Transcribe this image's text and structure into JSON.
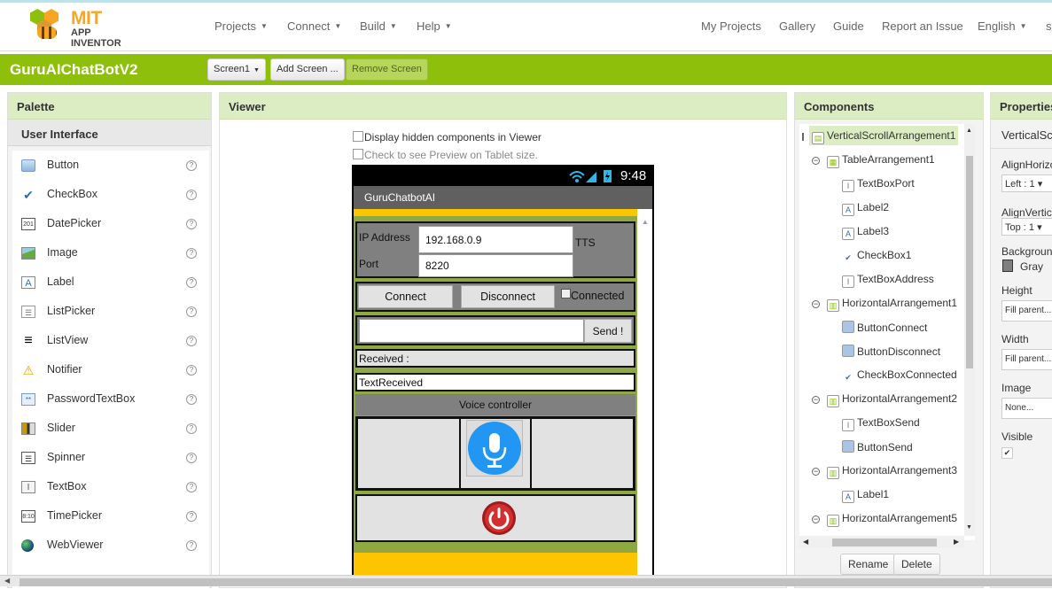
{
  "header": {
    "logo_mit": "MIT",
    "logo_ai": "APP INVENTOR",
    "menus": [
      "Projects",
      "Connect",
      "Build",
      "Help"
    ],
    "links": [
      "My Projects",
      "Gallery",
      "Guide",
      "Report an Issue"
    ],
    "language": "English",
    "cut_link": "s"
  },
  "projectbar": {
    "project_name": "GuruAIChatBotV2",
    "screen_select": "Screen1",
    "add_screen": "Add Screen ...",
    "remove_screen": "Remove Screen"
  },
  "palette": {
    "title": "Palette",
    "section": "User Interface",
    "help_glyph": "?",
    "items": [
      {
        "label": "Button",
        "icon": "button-icon"
      },
      {
        "label": "CheckBox",
        "icon": "checkbox-icon"
      },
      {
        "label": "DatePicker",
        "icon": "datepicker-icon"
      },
      {
        "label": "Image",
        "icon": "image-icon"
      },
      {
        "label": "Label",
        "icon": "label-icon"
      },
      {
        "label": "ListPicker",
        "icon": "listpicker-icon"
      },
      {
        "label": "ListView",
        "icon": "listview-icon"
      },
      {
        "label": "Notifier",
        "icon": "notifier-icon"
      },
      {
        "label": "PasswordTextBox",
        "icon": "password-icon"
      },
      {
        "label": "Slider",
        "icon": "slider-icon"
      },
      {
        "label": "Spinner",
        "icon": "spinner-icon"
      },
      {
        "label": "TextBox",
        "icon": "textbox-icon"
      },
      {
        "label": "TimePicker",
        "icon": "timepicker-icon"
      },
      {
        "label": "WebViewer",
        "icon": "webviewer-icon"
      }
    ]
  },
  "viewer": {
    "title": "Viewer",
    "display_hidden": "Display hidden components in Viewer",
    "tablet_preview": "Check to see Preview on Tablet size.",
    "phone": {
      "time": "9:48",
      "app_title": "GuruChatbotAI",
      "ip_label": "IP Address",
      "ip_value": "192.168.0.9",
      "tts_label": "TTS",
      "port_label": "Port",
      "port_value": "8220",
      "connect_btn": "Connect",
      "disconnect_btn": "Disconnect",
      "connected_label": "Connected",
      "send_btn": "Send !",
      "received_label": "Received :",
      "text_received": "TextReceived",
      "voice_label": "Voice controller"
    }
  },
  "components": {
    "title": "Components",
    "tree": [
      {
        "label": "VerticalScrollArrangement1",
        "icon": "vertical-arrangement-icon",
        "level": 0,
        "selected": true
      },
      {
        "label": "TableArrangement1",
        "icon": "table-arrangement-icon",
        "level": 1,
        "toggle": "−"
      },
      {
        "label": "TextBoxPort",
        "icon": "textbox-icon",
        "level": 2
      },
      {
        "label": "Label2",
        "icon": "label-icon",
        "level": 2
      },
      {
        "label": "Label3",
        "icon": "label-icon",
        "level": 2
      },
      {
        "label": "CheckBox1",
        "icon": "checkbox-icon",
        "level": 2
      },
      {
        "label": "TextBoxAddress",
        "icon": "textbox-icon",
        "level": 2
      },
      {
        "label": "HorizontalArrangement1",
        "icon": "horizontal-arrangement-icon",
        "level": 1,
        "toggle": "−"
      },
      {
        "label": "ButtonConnect",
        "icon": "button-icon",
        "level": 2
      },
      {
        "label": "ButtonDisconnect",
        "icon": "button-icon",
        "level": 2
      },
      {
        "label": "CheckBoxConnected",
        "icon": "checkbox-icon",
        "level": 2
      },
      {
        "label": "HorizontalArrangement2",
        "icon": "horizontal-arrangement-icon",
        "level": 1,
        "toggle": "−"
      },
      {
        "label": "TextBoxSend",
        "icon": "textbox-icon",
        "level": 2
      },
      {
        "label": "ButtonSend",
        "icon": "button-icon",
        "level": 2
      },
      {
        "label": "HorizontalArrangement3",
        "icon": "horizontal-arrangement-icon",
        "level": 1,
        "toggle": "−"
      },
      {
        "label": "Label1",
        "icon": "label-icon",
        "level": 2
      },
      {
        "label": "HorizontalArrangement5",
        "icon": "horizontal-arrangement-icon",
        "level": 1,
        "toggle": "−"
      }
    ],
    "rename_btn": "Rename",
    "delete_btn": "Delete"
  },
  "properties": {
    "title": "Properties",
    "component": "VerticalSc",
    "rows": [
      {
        "label": "AlignHorizo",
        "value": "Left : 1 ▾"
      },
      {
        "label": "AlignVertic",
        "value": "Top : 1 ▾"
      },
      {
        "label": "Backgroun",
        "value": "Gray"
      },
      {
        "label": "Height",
        "value": "Fill parent..."
      },
      {
        "label": "Width",
        "value": "Fill parent..."
      },
      {
        "label": "Image",
        "value": "None..."
      },
      {
        "label": "Visible",
        "value": "✔"
      }
    ]
  },
  "colors": {
    "accent_green": "#8dbf0b",
    "panel_header": "#dcedc3",
    "app_yellow": "#fdc500",
    "mic_blue": "#2196f3",
    "power_red": "#d32f2f"
  }
}
